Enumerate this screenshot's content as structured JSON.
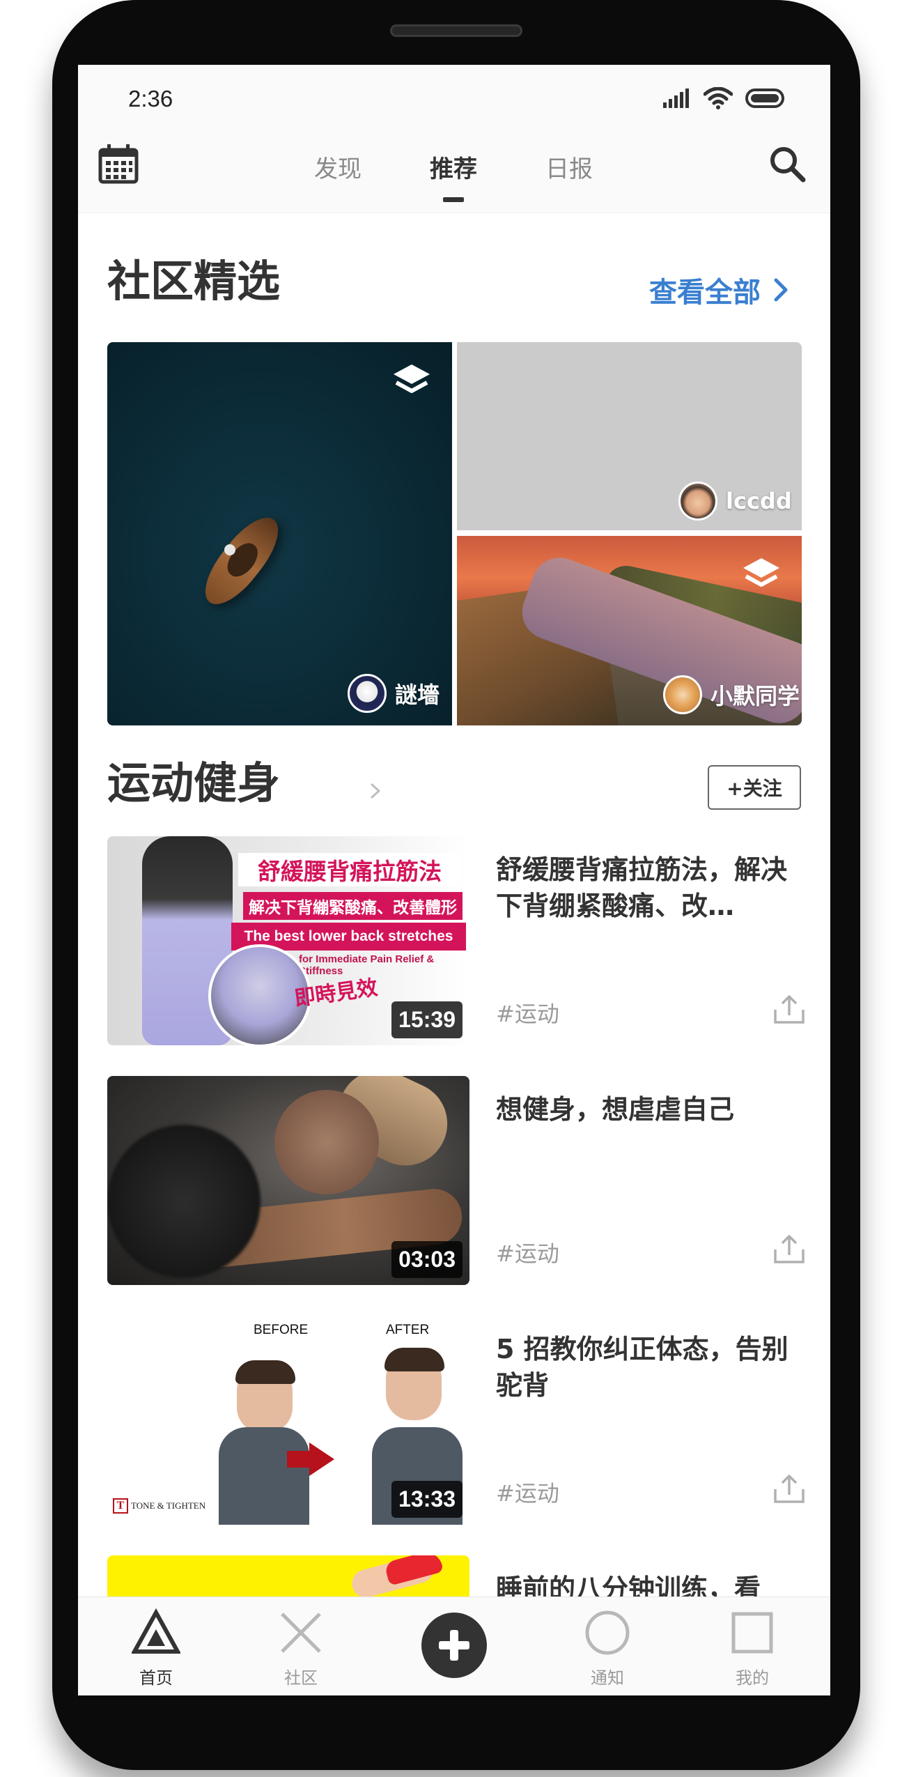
{
  "status_bar": {
    "time": "2:36"
  },
  "top_nav": {
    "tabs": [
      {
        "label": "发现",
        "active": false
      },
      {
        "label": "推荐",
        "active": true
      },
      {
        "label": "日报",
        "active": false
      }
    ],
    "left_icon": "calendar-icon",
    "right_icon": "search-icon"
  },
  "featured": {
    "title": "社区精选",
    "see_all": "查看全部",
    "tiles": [
      {
        "user": "謎墻",
        "icon": "layers-icon"
      },
      {
        "user": "lccdd"
      },
      {
        "user": "小默同学",
        "icon": "layers-icon"
      }
    ]
  },
  "fitness": {
    "title": "运动健身",
    "follow_label": "+关注",
    "thumb1": {
      "banner1": "舒緩腰背痛拉筋法",
      "banner2": "解决下背繃緊酸痛、改善體形",
      "banner3": "The best lower back stretches",
      "sub": "for Immediate Pain Relief & Stiffness",
      "stamp": "即時見效"
    },
    "thumb3": {
      "before": "BEFORE",
      "after": "AFTER",
      "logo": "TONE & TIGHTEN",
      "logo_letter": "T"
    },
    "videos": [
      {
        "title": "舒缓腰背痛拉筋法，解决下背绷紧酸痛、改…",
        "tag": "#运动",
        "duration": "15:39"
      },
      {
        "title": "想健身，想虐虐自己",
        "tag": "#运动",
        "duration": "03:03"
      },
      {
        "title": "5 招教你纠正体态，告别驼背",
        "tag": "#运动",
        "duration": "13:33"
      },
      {
        "title": "睡前的八分钟训练，看",
        "tag": "",
        "duration": ""
      }
    ]
  },
  "bottom_nav": {
    "items": [
      {
        "label": "首页",
        "icon": "triangle-icon",
        "active": true
      },
      {
        "label": "社区",
        "icon": "x-icon",
        "active": false
      },
      {
        "label": "",
        "icon": "plus-icon",
        "active": false
      },
      {
        "label": "通知",
        "icon": "circle-icon",
        "active": false
      },
      {
        "label": "我的",
        "icon": "square-icon",
        "active": false
      }
    ]
  },
  "colors": {
    "accent_blue": "#3a7fd0",
    "text_dark": "#333333",
    "text_gray": "#9a9a9a",
    "brand_pink": "#d4145a"
  }
}
